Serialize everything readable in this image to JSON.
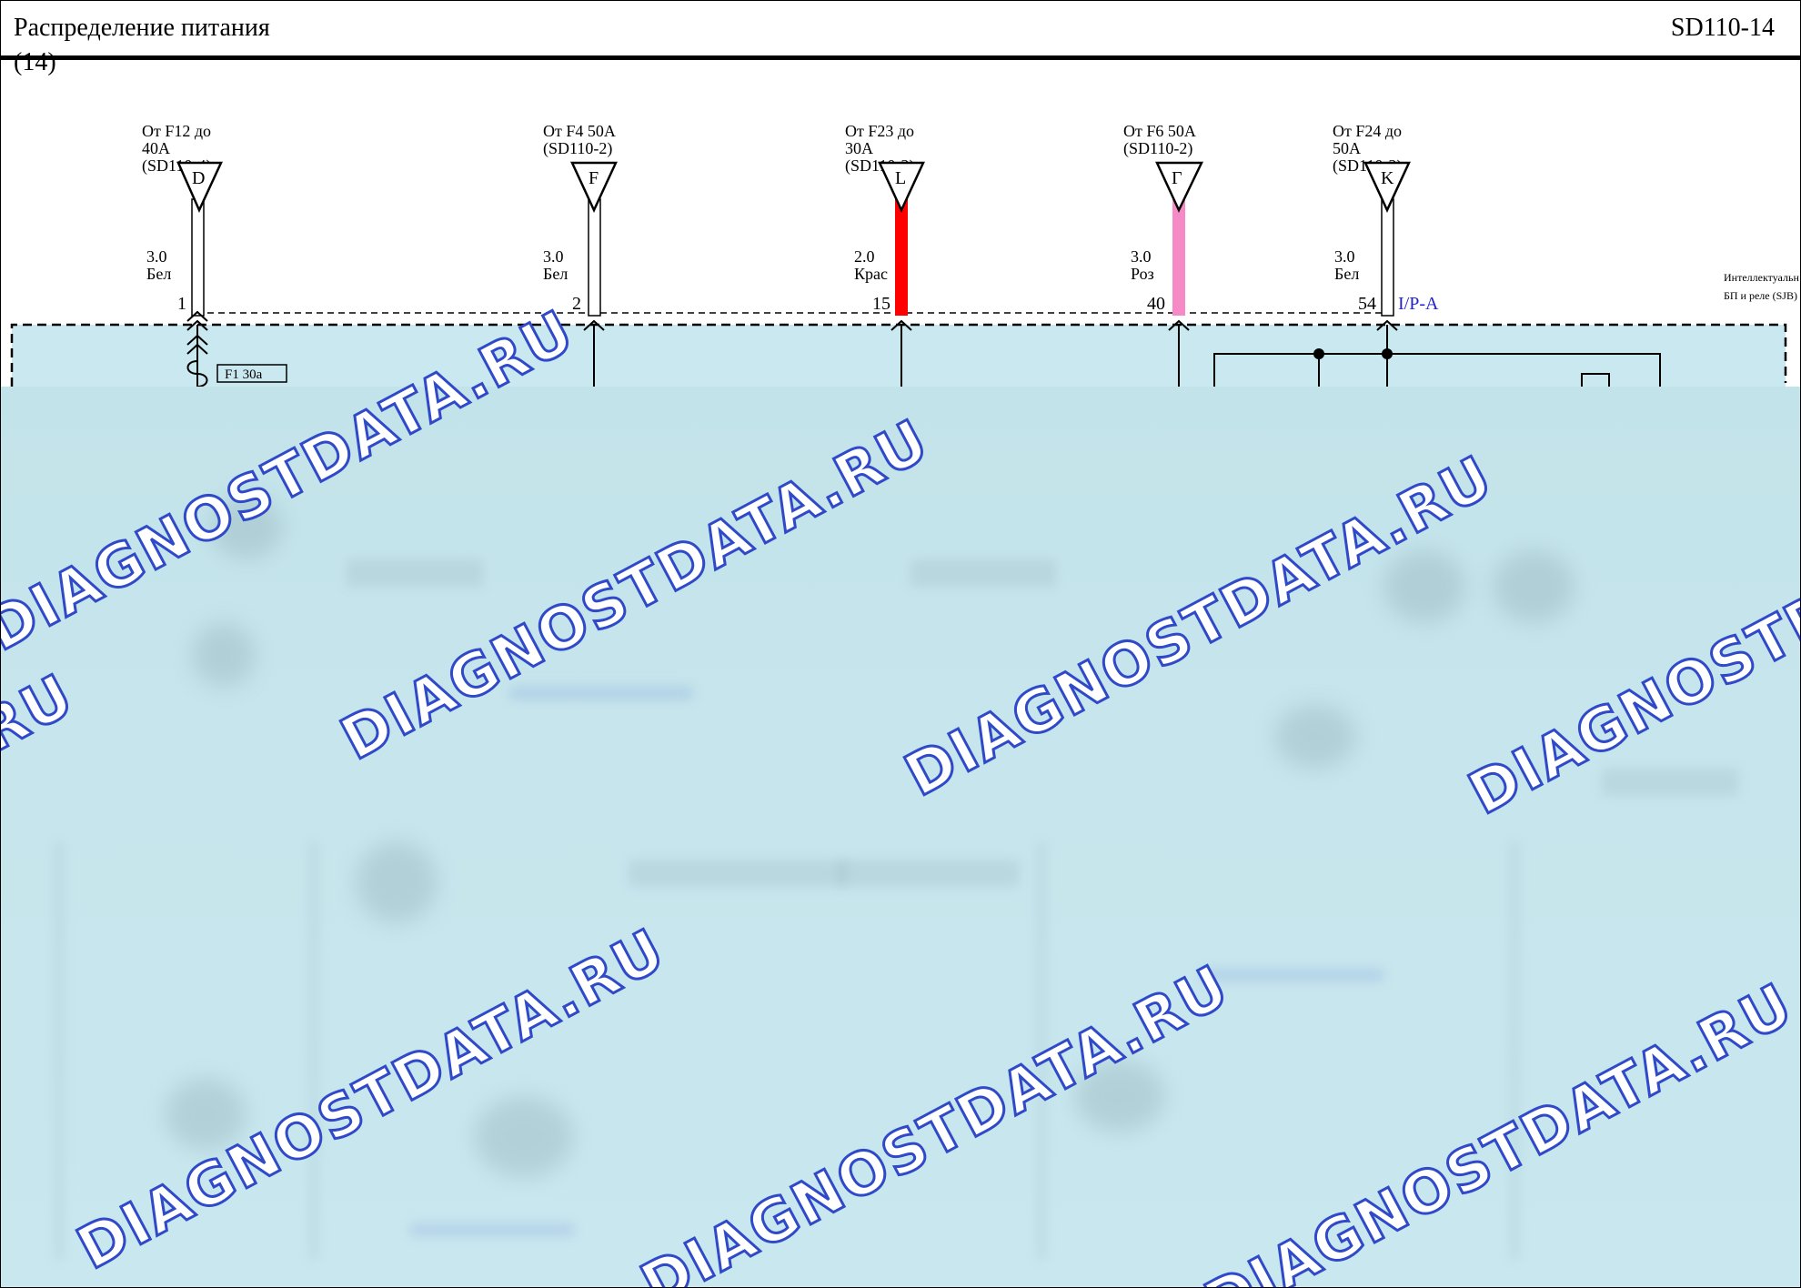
{
  "header": {
    "title": "Распределение питания",
    "code": "SD110-14",
    "page_number": "(14)"
  },
  "module_label": [
    "Интеллектуальн",
    "БП и реле (SJB)"
  ],
  "connector_label": "I/P-A",
  "fuse_label": "F1 30a",
  "wires": [
    {
      "from": [
        "От F12 до",
        "40A",
        "(SD110-4)"
      ],
      "letter": "D",
      "gauge": "3.0",
      "color_name": "Бел",
      "pin": "1",
      "color": "#ffffff"
    },
    {
      "from": [
        "От F4 50A",
        "(SD110-2)"
      ],
      "letter": "F",
      "gauge": "3.0",
      "color_name": "Бел",
      "pin": "2",
      "color": "#ffffff"
    },
    {
      "from": [
        "От F23 до",
        "30A",
        "(SD110-3)"
      ],
      "letter": "L",
      "gauge": "2.0",
      "color_name": "Крас",
      "pin": "15",
      "color": "#ff0000"
    },
    {
      "from": [
        "От F6 50A",
        "(SD110-2)"
      ],
      "letter": "Г",
      "gauge": "3.0",
      "color_name": "Роз",
      "pin": "40",
      "color": "#f58ac6"
    },
    {
      "from": [
        "От F24 до",
        "50A",
        "(SD110-3)"
      ],
      "letter": "K",
      "gauge": "3.0",
      "color_name": "Бел",
      "pin": "54",
      "color": "#ffffff"
    }
  ],
  "watermark": "DIAGNOSTDATA.RU"
}
